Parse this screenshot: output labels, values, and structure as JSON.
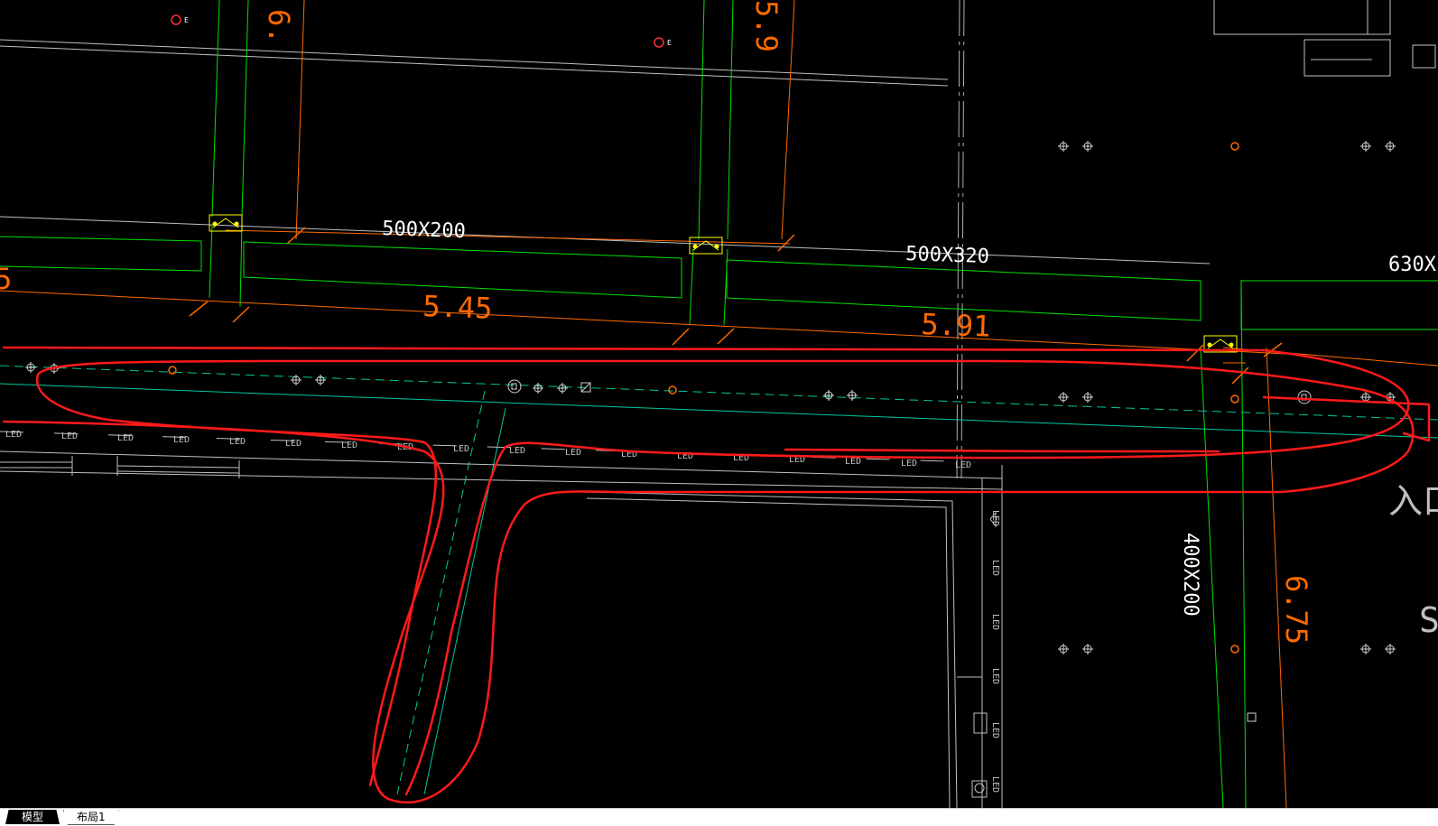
{
  "labels": {
    "duct_a": "500X200",
    "duct_b": "500X320",
    "duct_c": "630X",
    "duct_d": "400X200",
    "elev_a": "5.45",
    "elev_b": "5.91",
    "elev_c": "6.75",
    "elev_top_a": "6.",
    "elev_top_b": "5.9",
    "edge_digit": "5",
    "right_text": "入口",
    "right_s": "S",
    "led": "LED",
    "marker_e": "E"
  },
  "tabs": [
    {
      "label": "模型",
      "active": true
    },
    {
      "label": "布局1",
      "active": false
    }
  ],
  "colors": {
    "background": "#000000",
    "green": "#00ff00",
    "orange": "#ff6a00",
    "white": "#ffffff",
    "gray": "#c0c0c0",
    "cyan": "#00c8a0",
    "red_markup": "#ff1a1a",
    "yellow": "#ffff00"
  },
  "icons": [
    "crosshair-fixture-icon",
    "orange-dot-icon",
    "speaker-icon",
    "square-sensor-icon",
    "duct-fitting-icon"
  ]
}
